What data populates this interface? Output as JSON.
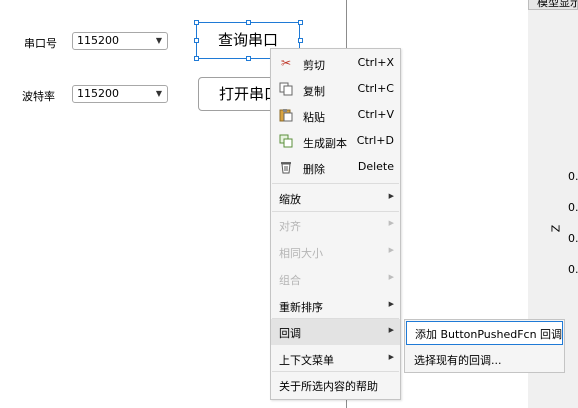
{
  "form": {
    "serial_label": "串口号",
    "serial_value": "115200",
    "baud_label": "波特率",
    "baud_value": "115200",
    "query_button": "查询串口",
    "open_button": "打开串口"
  },
  "right_panel": {
    "tab_label": "模型显示",
    "axis_label": "Z",
    "ticks": [
      "0.",
      "0.",
      "0.",
      "0."
    ]
  },
  "context_menu": {
    "cut": {
      "label": "剪切",
      "shortcut": "Ctrl+X"
    },
    "copy": {
      "label": "复制",
      "shortcut": "Ctrl+C"
    },
    "paste": {
      "label": "粘贴",
      "shortcut": "Ctrl+V"
    },
    "duplicate": {
      "label": "生成副本",
      "shortcut": "Ctrl+D"
    },
    "delete": {
      "label": "删除",
      "shortcut": "Delete"
    },
    "zoom": "缩放",
    "align": "对齐",
    "same_size": "相同大小",
    "group": "组合",
    "reorder": "重新排序",
    "callback": "回调",
    "context_menu": "上下文菜单",
    "help": "关于所选内容的帮助"
  },
  "callback_submenu": {
    "add": "添加 ButtonPushedFcn 回调",
    "select": "选择现有的回调..."
  },
  "colors": {
    "selection": "#1f7ad6",
    "menu_bg": "#f5f5f5",
    "highlight": "#e3e3e3",
    "submenu_border": "#1f7ad6"
  }
}
